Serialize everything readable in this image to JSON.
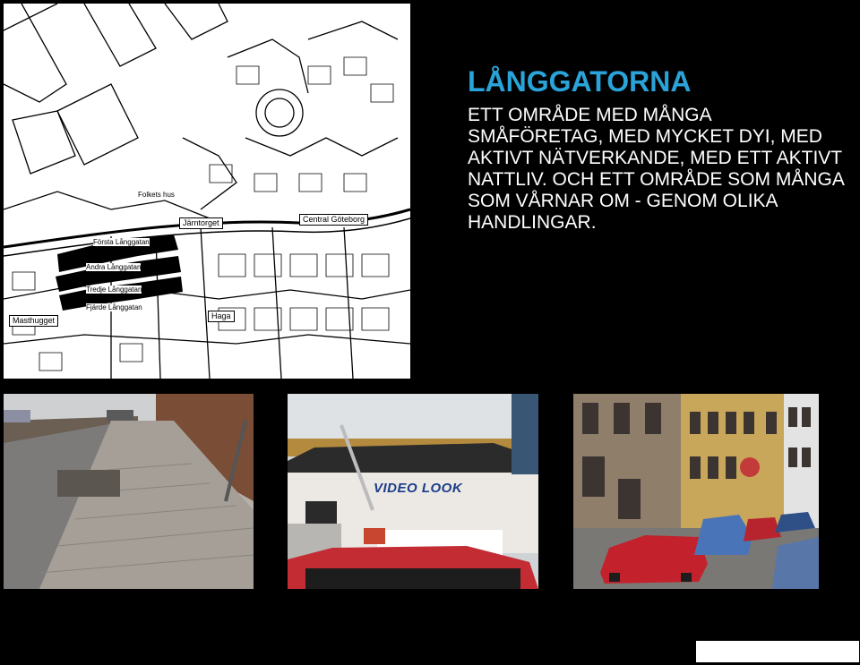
{
  "heading": {
    "title": "LÅNGGATORNA",
    "body": "ETT OMRÅDE MED MÅNGA SMÅFÖRETAG, MED MYCKET DYI, MED AKTIVT NÄTVERKANDE, MED ETT AKTIVT NATTLIV. OCH ETT OMRÅDE SOM MÅNGA SOM VÅRNAR OM - GENOM OLIKA HANDLINGAR."
  },
  "map": {
    "labels": {
      "central": "Central Göteborg",
      "jarntorget": "Järntorget",
      "haga": "Haga",
      "masthugget": "Masthugget",
      "folketshus": "Folkets hus",
      "langgatan1": "Första Långgatan",
      "langgatan2": "Andra Långgatan",
      "langgatan3": "Tredje Långgatan",
      "langgatan4": "Fjärde Långgatan"
    }
  },
  "photos": {
    "storefront_sign": "VIDEO LOOK"
  },
  "colors": {
    "accent": "#2aa3d9",
    "background": "#000000",
    "text": "#ffffff"
  }
}
